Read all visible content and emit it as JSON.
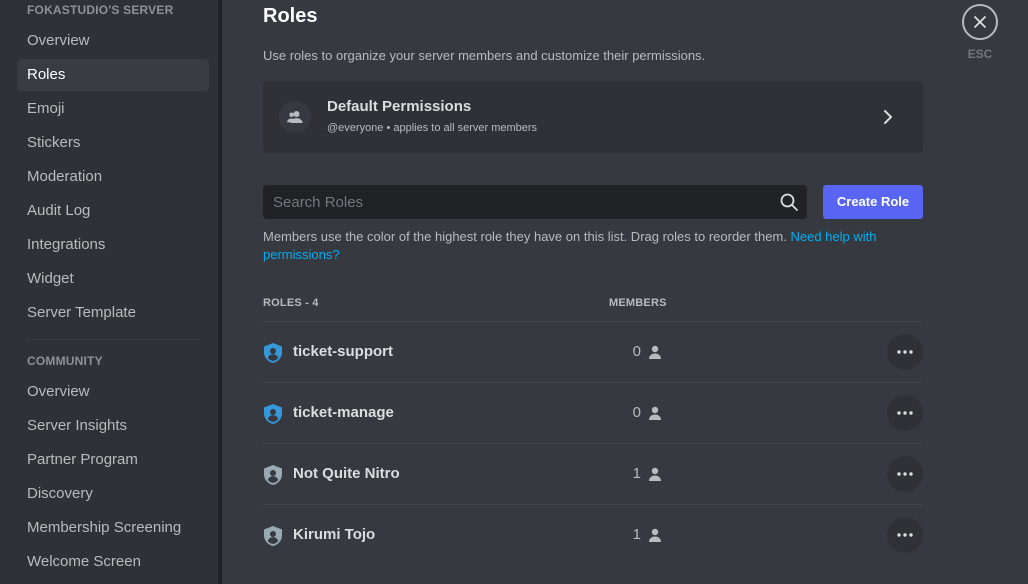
{
  "sidebar": {
    "server_header": "FOKASTUDIO'S SERVER",
    "items": [
      {
        "label": "Overview"
      },
      {
        "label": "Roles"
      },
      {
        "label": "Emoji"
      },
      {
        "label": "Stickers"
      },
      {
        "label": "Moderation"
      },
      {
        "label": "Audit Log"
      },
      {
        "label": "Integrations"
      },
      {
        "label": "Widget"
      },
      {
        "label": "Server Template"
      }
    ],
    "selected": "Roles",
    "community_header": "COMMUNITY",
    "community_items": [
      {
        "label": "Overview"
      },
      {
        "label": "Server Insights"
      },
      {
        "label": "Partner Program"
      },
      {
        "label": "Discovery"
      },
      {
        "label": "Membership Screening"
      },
      {
        "label": "Welcome Screen"
      }
    ]
  },
  "main": {
    "title": "Roles",
    "description": "Use roles to organize your server members and customize their permissions.",
    "default_permissions": {
      "title": "Default Permissions",
      "subtitle": "@everyone • applies to all server members"
    },
    "search": {
      "placeholder": "Search Roles"
    },
    "create_role_label": "Create Role",
    "help_text": "Members use the color of the highest role they have on this list. Drag roles to reorder them. ",
    "help_link": "Need help with permissions?",
    "columns": {
      "roles": "ROLES - 4",
      "members": "MEMBERS"
    },
    "roles": [
      {
        "name": "ticket-support",
        "members": "0",
        "color": "#3498db"
      },
      {
        "name": "ticket-manage",
        "members": "0",
        "color": "#3498db"
      },
      {
        "name": "Not Quite Nitro",
        "members": "1",
        "color": "#99aab5"
      },
      {
        "name": "Kirumi Tojo",
        "members": "1",
        "color": "#99aab5"
      }
    ]
  },
  "close": {
    "esc_label": "ESC"
  },
  "colors": {
    "sidebar_bg": "#2f3136",
    "main_bg": "#36393f",
    "accent": "#5865f2",
    "link": "#00aff4"
  }
}
